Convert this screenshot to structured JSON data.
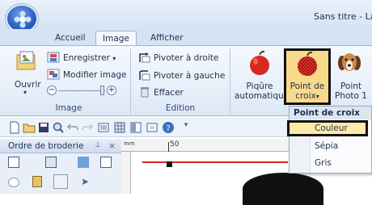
{
  "window": {
    "title": "Sans titre - Lay"
  },
  "tabs": [
    {
      "label": "Accueil"
    },
    {
      "label": "Image"
    },
    {
      "label": "Afficher"
    }
  ],
  "ribbon": {
    "image_group": {
      "label": "Image",
      "open_label": "Ouvrir",
      "save_label": "Enregistrer",
      "modify_label": "Modifier image"
    },
    "edition_group": {
      "label": "Edition",
      "rotate_right": "Pivoter à droite",
      "rotate_left": "Pivoter à gauche",
      "delete": "Effacer"
    },
    "big_buttons": [
      {
        "line1": "Piqûre",
        "line2": "automatique"
      },
      {
        "line1": "Point de",
        "line2": "croix"
      },
      {
        "line1": "Point",
        "line2": "Photo 1"
      }
    ]
  },
  "panel": {
    "title": "Ordre de broderie"
  },
  "ruler": {
    "unit": "mm",
    "mark": "50"
  },
  "dropdown": {
    "header": "Point de croix",
    "items": [
      {
        "label": "Couleur",
        "selected": true
      },
      {
        "label": "Sépia",
        "selected": false
      },
      {
        "label": "Gris",
        "selected": false
      }
    ]
  },
  "colors": {
    "accent": "#fde9a8",
    "selection_border": "#111111",
    "ribbon": "#dde8f6"
  }
}
